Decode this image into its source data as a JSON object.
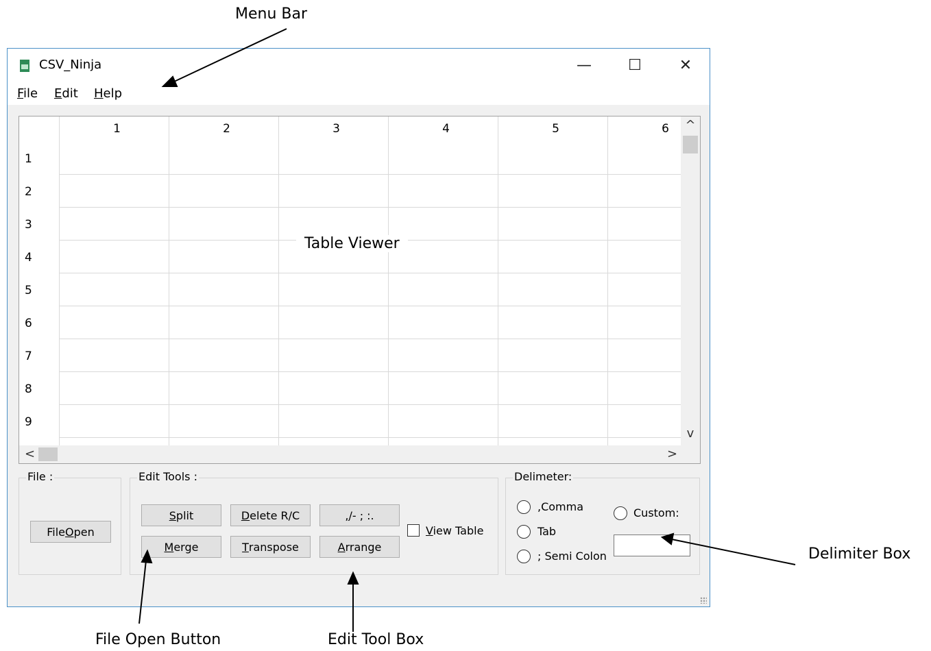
{
  "annotations": {
    "menu_bar": "Menu Bar",
    "table_viewer": "Table Viewer",
    "delimiter_box": "Delimiter Box",
    "file_open_button": "File Open Button",
    "edit_tool_box": "Edit Tool Box"
  },
  "window": {
    "title": "CSV_Ninja",
    "minimize": "—",
    "maximize": "☐",
    "close": "✕",
    "icon": "csv-file-icon"
  },
  "menu": {
    "file": {
      "accel": "F",
      "rest": "ile"
    },
    "edit": {
      "accel": "E",
      "rest": "dit"
    },
    "help": {
      "accel": "H",
      "rest": "elp"
    }
  },
  "grid": {
    "column_headers": [
      "1",
      "2",
      "3",
      "4",
      "5",
      "6"
    ],
    "row_headers": [
      "1",
      "2",
      "3",
      "4",
      "5",
      "6",
      "7",
      "8",
      "9"
    ]
  },
  "scrollbars": {
    "up": "^",
    "down": "v",
    "left": "<",
    "right": ">"
  },
  "file_group": {
    "title": "File :",
    "open_button": {
      "pre": "File ",
      "accel": "O",
      "post": "pen"
    }
  },
  "edit_group": {
    "title": "Edit Tools :",
    "split": {
      "pre": "",
      "accel": "S",
      "post": "plit"
    },
    "delete": {
      "pre": "",
      "accel": "D",
      "post": "elete R/C"
    },
    "symbols": {
      "pre": "",
      "accel": ",",
      "post": "/- ; :."
    },
    "merge": {
      "pre": "",
      "accel": "M",
      "post": "erge"
    },
    "transpose": {
      "pre": "",
      "accel": "T",
      "post": "ranspose"
    },
    "arrange": {
      "pre": "",
      "accel": "A",
      "post": "rrange"
    },
    "view_table": {
      "pre": "",
      "accel": "V",
      "post": "iew Table"
    }
  },
  "delimiter_group": {
    "title": "Delimeter:",
    "comma": ",Comma",
    "tab": "Tab",
    "semicolon": "; Semi Colon",
    "custom": "Custom:",
    "custom_value": ""
  }
}
